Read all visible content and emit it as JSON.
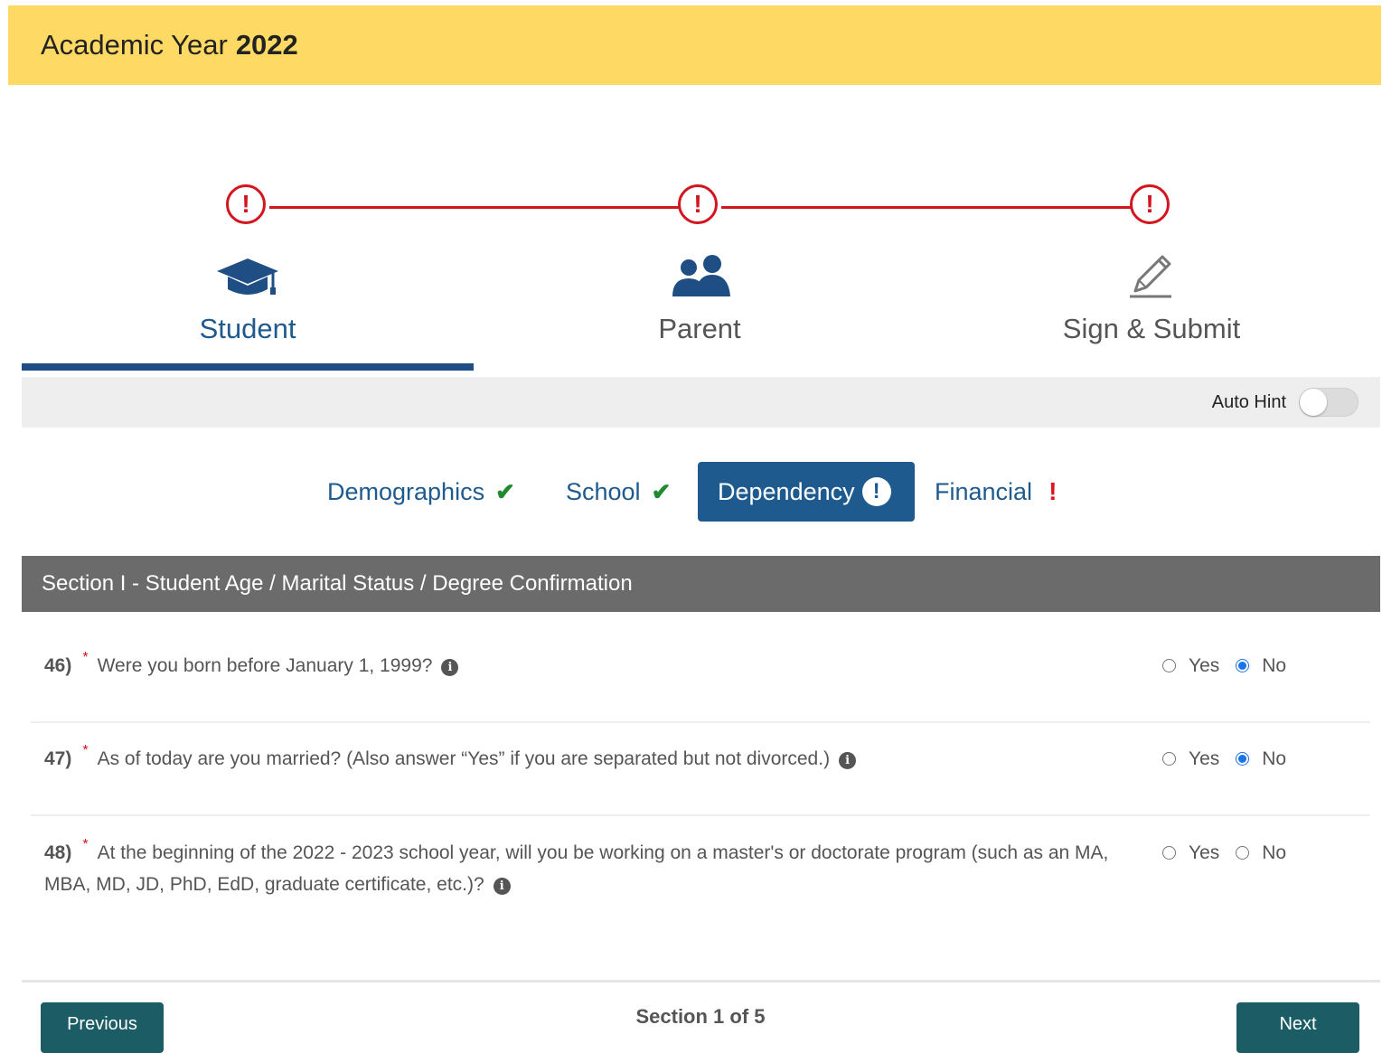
{
  "header": {
    "title_prefix": "Academic Year",
    "title_year": "2022"
  },
  "steps": [
    {
      "label": "Student",
      "icon": "graduation-cap-icon",
      "status": "!",
      "active": true
    },
    {
      "label": "Parent",
      "icon": "users-icon",
      "status": "!",
      "active": false
    },
    {
      "label": "Sign & Submit",
      "icon": "pencil-icon",
      "status": "!",
      "active": false
    }
  ],
  "auto_hint": {
    "label": "Auto Hint",
    "enabled": false
  },
  "subtabs": [
    {
      "label": "Demographics",
      "status": "complete",
      "status_glyph": "✔"
    },
    {
      "label": "School",
      "status": "complete",
      "status_glyph": "✔"
    },
    {
      "label": "Dependency",
      "status": "incomplete",
      "status_glyph": "!"
    },
    {
      "label": "Financial",
      "status": "incomplete",
      "status_glyph": "!"
    }
  ],
  "section": {
    "title": "Section I - Student Age / Marital Status / Degree Confirmation"
  },
  "questions": [
    {
      "number": "46)",
      "required_mark": "*",
      "text": "Were you born before January 1, 1999?",
      "options": [
        "Yes",
        "No"
      ],
      "selected": "No"
    },
    {
      "number": "47)",
      "required_mark": "*",
      "text": "As of today are you married? (Also answer “Yes” if you are separated but not divorced.)",
      "options": [
        "Yes",
        "No"
      ],
      "selected": "No"
    },
    {
      "number": "48)",
      "required_mark": "*",
      "text": "At the beginning of the 2022 - 2023 school year, will you be working on a master's or doctorate program (such as an MA, MBA, MD, JD, PhD, EdD, graduate certificate, etc.)?",
      "options": [
        "Yes",
        "No"
      ],
      "selected": ""
    }
  ],
  "info_glyph": "i",
  "footer": {
    "previous_label": "Previous",
    "next_label": "Next",
    "section_count": "Section 1 of 5"
  },
  "colors": {
    "header_bg": "#fed963",
    "primary": "#1f5a8e",
    "error": "#d2151e",
    "success": "#1f8a2e",
    "button": "#1c5c64",
    "section_bar": "#6b6b6b"
  }
}
